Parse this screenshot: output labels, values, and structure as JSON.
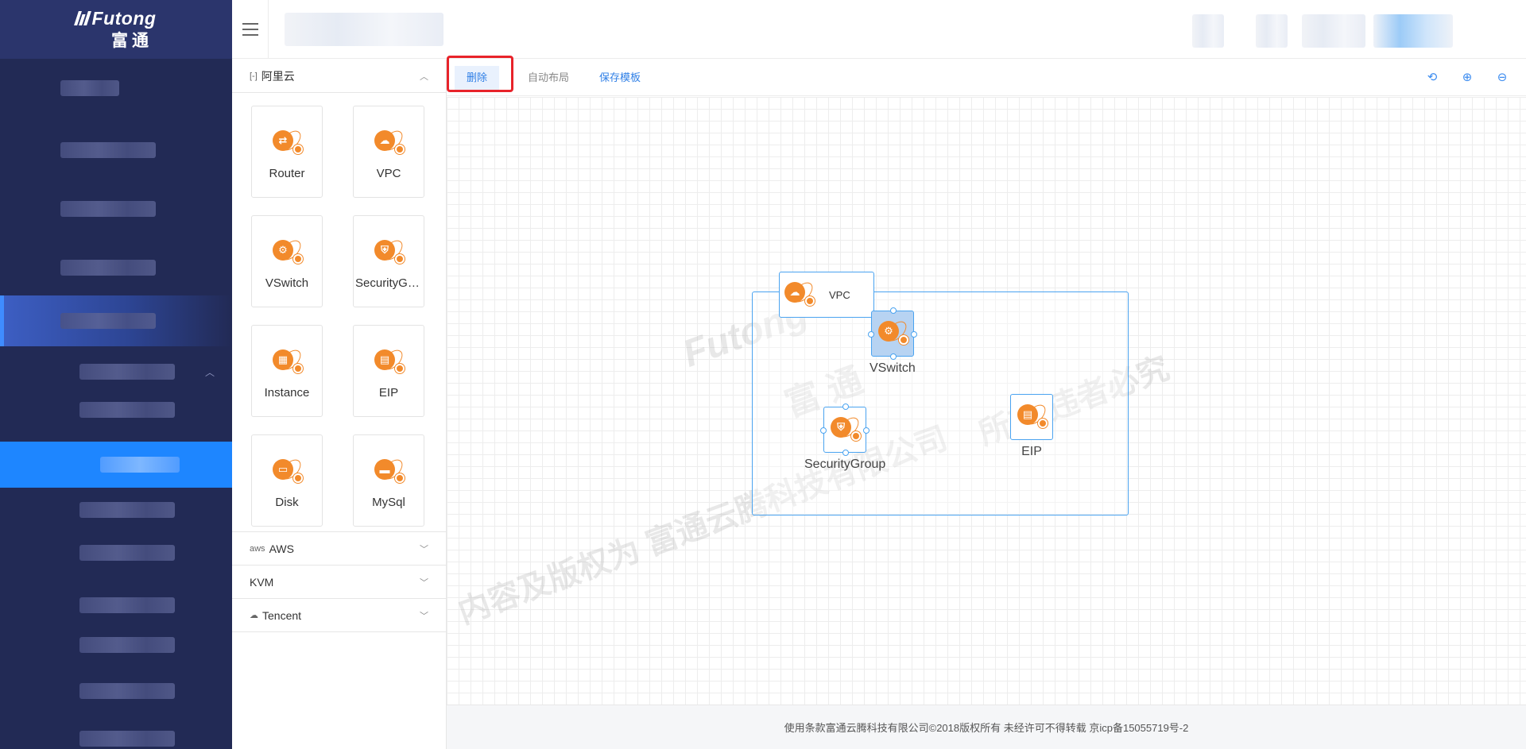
{
  "app": {
    "brand_name": "Futong",
    "brand_sub": "富通"
  },
  "palette": {
    "groups": [
      {
        "name": "阿里云",
        "expanded": true,
        "icon": "aliyun-icon",
        "items": [
          {
            "label": "Router",
            "glyph": "router"
          },
          {
            "label": "VPC",
            "glyph": "vpc"
          },
          {
            "label": "VSwitch",
            "glyph": "vswitch"
          },
          {
            "label": "SecurityGroup",
            "glyph": "security-group"
          },
          {
            "label": "Instance",
            "glyph": "instance"
          },
          {
            "label": "EIP",
            "glyph": "eip"
          },
          {
            "label": "Disk",
            "glyph": "disk"
          },
          {
            "label": "MySql",
            "glyph": "mysql"
          }
        ]
      },
      {
        "name": "AWS",
        "expanded": false,
        "icon": "aws-icon",
        "prefix": "aws"
      },
      {
        "name": "KVM",
        "expanded": false
      },
      {
        "name": "Tencent",
        "expanded": false,
        "icon": "cloud-icon"
      }
    ]
  },
  "toolbar": {
    "delete_label": "删除",
    "auto_layout_label": "自动布局",
    "save_template_label": "保存模板",
    "icons": [
      "reset-icon",
      "zoom-in-icon",
      "zoom-out-icon"
    ]
  },
  "diagram": {
    "container_label": "VPC",
    "nodes": [
      {
        "label": "VSwitch",
        "glyph": "vswitch",
        "selected": true
      },
      {
        "label": "SecurityGroup",
        "glyph": "security-group",
        "selected": false
      },
      {
        "label": "EIP",
        "glyph": "eip",
        "selected": false
      }
    ]
  },
  "watermark": {
    "line1": "Futong",
    "line2": "富 通",
    "line3": "所有 违者必究",
    "line4": "内容及版权为 富通云腾科技有限公司"
  },
  "footer": {
    "text": "使用条款富通云腾科技有限公司©2018版权所有 未经许可不得转载 京icp备15055719号-2"
  },
  "colors": {
    "nav_bg": "#222a55",
    "nav_active": "#1e86ff",
    "accent": "#2f7fe6",
    "resource_orange": "#f28a2b",
    "highlight_red": "#e8232a"
  }
}
